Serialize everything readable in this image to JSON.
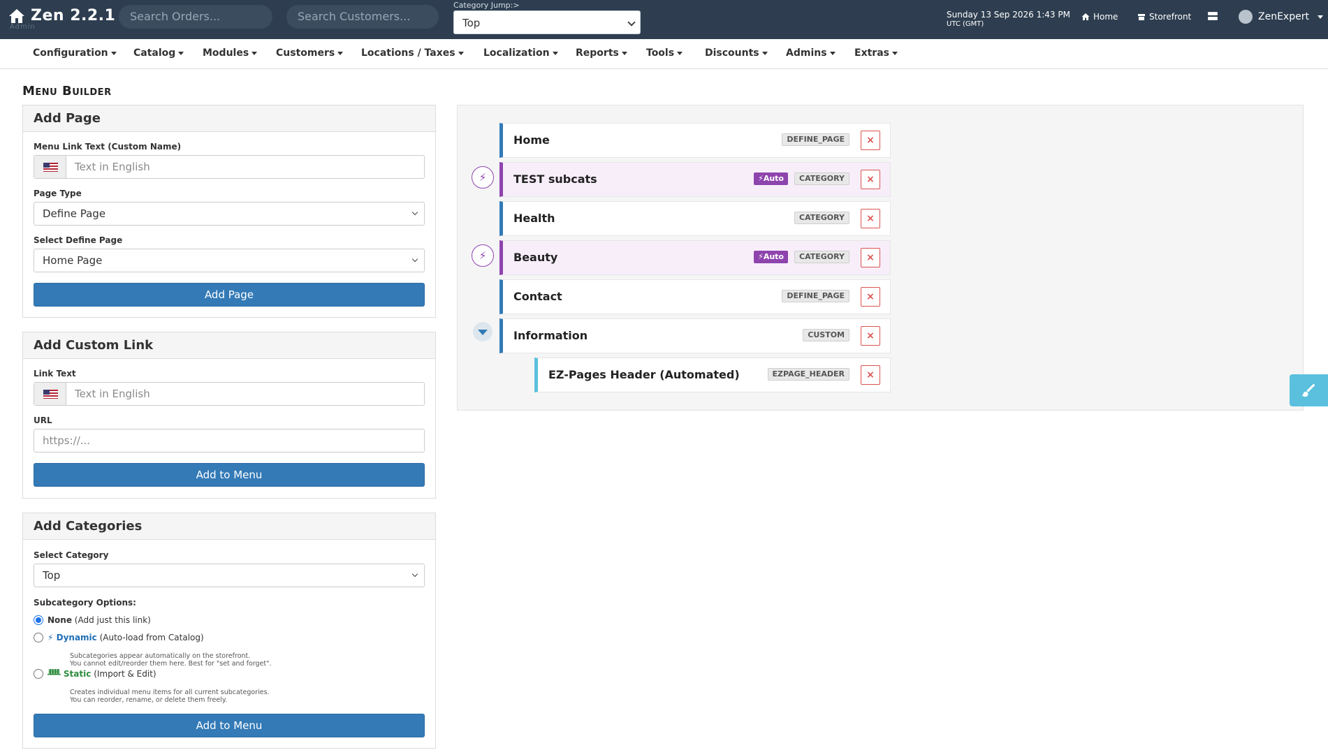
{
  "app": {
    "brand": "Zen 2.2.1",
    "brand_sub": "Admin",
    "search_orders_placeholder": "Search Orders...",
    "search_customers_placeholder": "Search Customers...",
    "category_jump_label": "Category Jump:>",
    "category_jump_value": "Top",
    "datetime": "Sunday 13 Sep 2026 1:43 PM",
    "timezone": "UTC (GMT)",
    "home_link": "Home",
    "storefront_link": "Storefront",
    "user_name": "ZenExpert"
  },
  "nav": {
    "items": [
      {
        "label": "Configuration"
      },
      {
        "label": "Catalog"
      },
      {
        "label": "Modules"
      },
      {
        "label": "Customers"
      },
      {
        "label": "Locations / Taxes"
      },
      {
        "label": "Localization"
      },
      {
        "label": "Reports"
      },
      {
        "label": "Tools"
      },
      {
        "label": "Discounts"
      },
      {
        "label": "Admins"
      },
      {
        "label": "Extras"
      }
    ]
  },
  "page": {
    "title": "Menu Builder"
  },
  "add_page": {
    "title": "Add Page",
    "link_text_label": "Menu Link Text (Custom Name)",
    "link_text_placeholder": "Text in English",
    "page_type_label": "Page Type",
    "page_type_value": "Define Page",
    "define_page_label": "Select Define Page",
    "define_page_value": "Home Page",
    "button": "Add Page"
  },
  "add_custom_link": {
    "title": "Add Custom Link",
    "link_text_label": "Link Text",
    "link_text_placeholder": "Text in English",
    "url_label": "URL",
    "url_placeholder": "https://...",
    "button": "Add to Menu"
  },
  "add_categories": {
    "title": "Add Categories",
    "select_label": "Select Category",
    "select_value": "Top",
    "options_label": "Subcategory Options:",
    "none_strong": "None",
    "none_text": "(Add just this link)",
    "dynamic_strong": "Dynamic",
    "dynamic_text": "(Auto-load from Catalog)",
    "dynamic_hint_1": "Subcategories appear automatically on the storefront.",
    "dynamic_hint_2": "You cannot edit/reorder them here. Best for \"set and forget\".",
    "static_strong": "Static",
    "static_text": "(Import & Edit)",
    "static_hint_1": "Creates individual menu items for all current subcategories.",
    "static_hint_2": "You can reorder, rename, or delete them freely.",
    "button": "Add to Menu"
  },
  "menu_items": [
    {
      "title": "Home",
      "type": "DEFINE_PAGE",
      "auto": false
    },
    {
      "title": "TEST subcats",
      "type": "CATEGORY",
      "auto": true,
      "auto_label": "Auto"
    },
    {
      "title": "Health",
      "type": "CATEGORY",
      "auto": false
    },
    {
      "title": "Beauty",
      "type": "CATEGORY",
      "auto": true,
      "auto_label": "Auto"
    },
    {
      "title": "Contact",
      "type": "DEFINE_PAGE",
      "auto": false
    },
    {
      "title": "Information",
      "type": "CUSTOM",
      "auto": false
    },
    {
      "title": "EZ-Pages Header (Automated)",
      "type": "EZPAGE_HEADER",
      "auto": false,
      "child": true
    }
  ],
  "delete_glyph": "×",
  "colors": {
    "topbar": "#2e3e50",
    "primary": "#337ab7",
    "auto": "#8e44ad",
    "danger": "#d9534f",
    "info": "#5bc0de"
  }
}
